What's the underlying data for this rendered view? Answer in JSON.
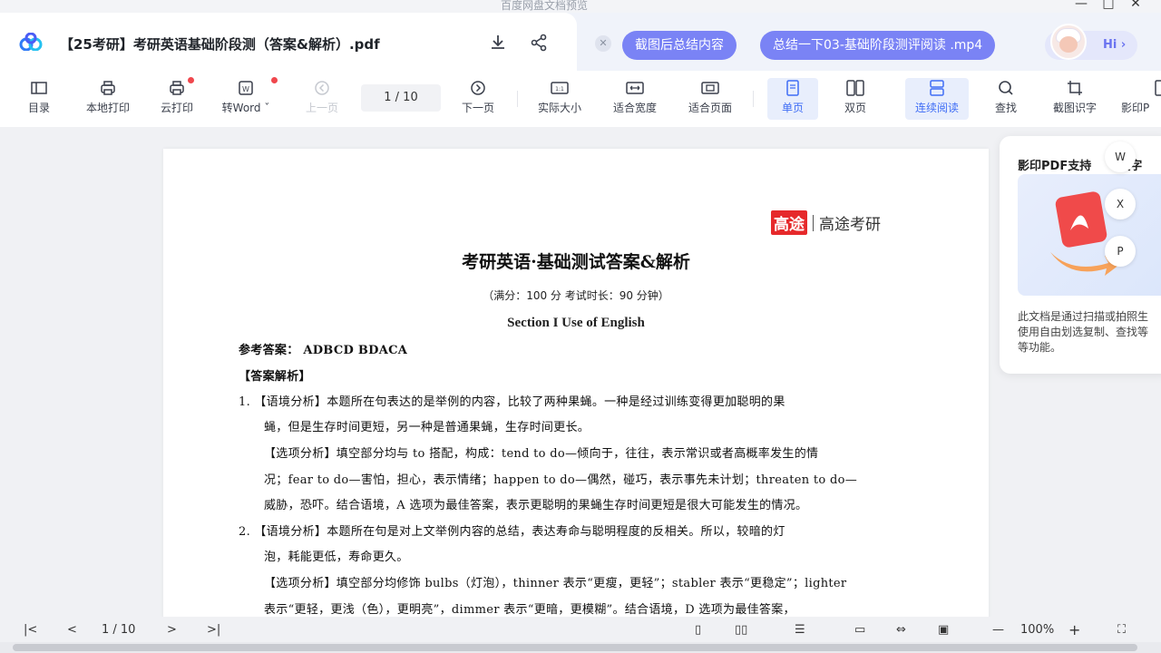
{
  "window": {
    "title": "百度网盘文档预览",
    "controls": [
      "minimize",
      "maximize",
      "close"
    ]
  },
  "header": {
    "file_name": "【25考研】考研英语基础阶段测（答案&解析）.pdf",
    "pill_summary": "截图后总结内容",
    "pill_video": "总结一下03-基础阶段测评阅读 .mp4",
    "hi_label": "Hi ›"
  },
  "toolbar": {
    "items": [
      {
        "label": "目录",
        "icon": "toc-icon"
      },
      {
        "label": "本地打印",
        "icon": "printer-icon"
      },
      {
        "label": "云打印",
        "icon": "cloud-print-icon"
      },
      {
        "label": "转Word ˇ",
        "icon": "word-icon"
      },
      {
        "label": "上一页",
        "icon": "prev-page-icon"
      },
      {
        "label": "下一页",
        "icon": "next-page-icon"
      },
      {
        "label": "实际大小",
        "icon": "actual-size-icon"
      },
      {
        "label": "适合宽度",
        "icon": "fit-width-icon"
      },
      {
        "label": "适合页面",
        "icon": "fit-page-icon"
      },
      {
        "label": "单页",
        "icon": "single-page-icon"
      },
      {
        "label": "双页",
        "icon": "double-page-icon"
      },
      {
        "label": "连续阅读",
        "icon": "continuous-icon"
      },
      {
        "label": "查找",
        "icon": "search-icon"
      },
      {
        "label": "截图识字",
        "icon": "screenshot-ocr-icon"
      },
      {
        "label": "影印P",
        "icon": "scan-pdf-icon"
      }
    ],
    "page_indicator": "1  /  10"
  },
  "document": {
    "brand_red": "高途",
    "brand_text": "高途考研",
    "title": "考研英语·基础测试答案&解析",
    "subtitle": "（满分：100 分  考试时长：90 分钟）",
    "section": "Section I    Use of English",
    "answers": "参考答案：  ADBCD      BDACA",
    "analysis_heading": "【答案解析】",
    "lines": [
      "1.     【语境分析】本题所在句表达的是举例的内容，比较了两种果蝇。一种是经过训练变得更加聪明的果",
      "蝇，但是生存时间更短，另一种是普通果蝇，生存时间更长。",
      "【选项分析】填空部分均与 to 搭配，构成：tend to do—倾向于，往往，表示常识或者高概率发生的情",
      "况；fear to do—害怕，担心，表示情绪；happen to do—偶然，碰巧，表示事先未计划；threaten to do—",
      "威胁，恐吓。结合语境，A 选项为最佳答案，表示更聪明的果蝇生存时间更短是很大可能发生的情况。",
      "2.     【语境分析】本题所在句是对上文举例内容的总结，表达寿命与聪明程度的反相关。所以，较暗的灯",
      "泡，耗能更低，寿命更久。",
      "【选项分析】填空部分均修饰 bulbs（灯泡），thinner 表示“更瘦，更轻”；stabler 表示“更稳定”；lighter",
      "表示“更轻，更浅（色），更明亮”，dimmer 表示“更暗，更模糊”。结合语境，D 选项为最佳答案，"
    ]
  },
  "float_panel": {
    "title": "影印PDF支持",
    "title_tail": "文字",
    "desc_lines": [
      "此文档是通过扫描或拍照生",
      "使用自由划选复制、查找等",
      "等功能。"
    ],
    "side_buttons": [
      "W",
      "X",
      "P"
    ]
  },
  "bottombar": {
    "page_indicator": "1  / 10",
    "zoom": "100%"
  },
  "colors": {
    "accent": "#3f6df5",
    "pill": "#7a83f5",
    "brand_red": "#e6292b"
  }
}
